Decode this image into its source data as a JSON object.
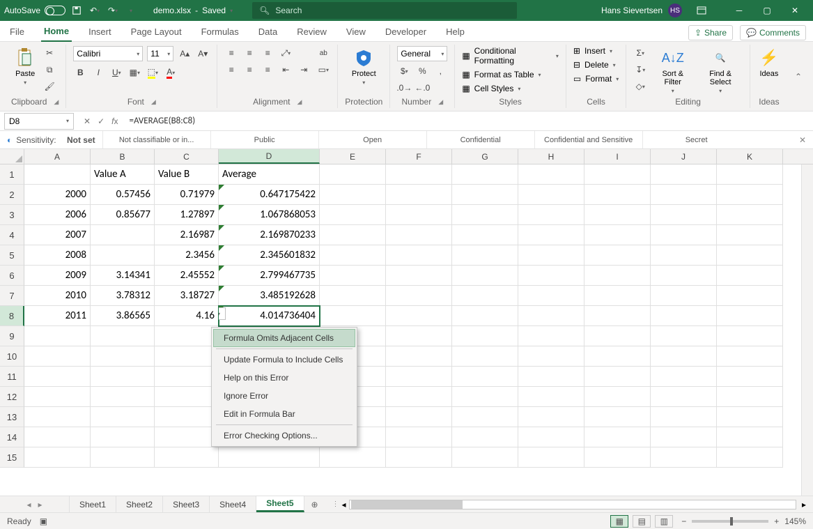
{
  "title": {
    "autosave": "AutoSave",
    "filename": "demo.xlsx",
    "saved": "Saved",
    "search_placeholder": "Search",
    "user": "Hans Sievertsen",
    "initials": "HS"
  },
  "tabs": {
    "file": "File",
    "home": "Home",
    "insert": "Insert",
    "pagelayout": "Page Layout",
    "formulas": "Formulas",
    "data": "Data",
    "review": "Review",
    "view": "View",
    "developer": "Developer",
    "help": "Help",
    "share": "Share",
    "comments": "Comments"
  },
  "ribbon": {
    "clipboard": {
      "paste": "Paste",
      "label": "Clipboard"
    },
    "font": {
      "name": "Calibri",
      "size": "11",
      "label": "Font"
    },
    "alignment": {
      "label": "Alignment"
    },
    "protection": {
      "protect": "Protect",
      "label": "Protection"
    },
    "number": {
      "format": "General",
      "label": "Number"
    },
    "styles": {
      "cond": "Conditional Formatting",
      "table": "Format as Table",
      "cell": "Cell Styles",
      "label": "Styles"
    },
    "cells": {
      "insert": "Insert",
      "delete": "Delete",
      "format": "Format",
      "label": "Cells"
    },
    "editing": {
      "sort": "Sort & Filter",
      "find": "Find & Select",
      "label": "Editing"
    },
    "ideas": {
      "ideas": "Ideas",
      "label": "Ideas"
    }
  },
  "fbar": {
    "name": "D8",
    "formula": "=AVERAGE(B8:C8)"
  },
  "sensitivity": {
    "label": "Sensitivity:",
    "value": "Not set",
    "opts": [
      "Not classifiable or in...",
      "Public",
      "Open",
      "Confidential",
      "Confidential and Sensitive",
      "Secret"
    ]
  },
  "grid": {
    "cols": [
      "A",
      "B",
      "C",
      "D",
      "E",
      "F",
      "G",
      "H",
      "I",
      "J",
      "K"
    ],
    "headers": {
      "B": "Value A",
      "C": "Value B",
      "D": "Average"
    },
    "data": [
      {
        "r": 2,
        "A": "2000",
        "B": "0.57456",
        "C": "0.71979",
        "D": "0.647175422"
      },
      {
        "r": 3,
        "A": "2006",
        "B": "0.85677",
        "C": "1.27897",
        "D": "1.067868053"
      },
      {
        "r": 4,
        "A": "2007",
        "B": "",
        "C": "2.16987",
        "D": "2.169870233"
      },
      {
        "r": 5,
        "A": "2008",
        "B": "",
        "C": "2.3456",
        "D": "2.345601832"
      },
      {
        "r": 6,
        "A": "2009",
        "B": "3.14341",
        "C": "2.45552",
        "D": "2.799467735"
      },
      {
        "r": 7,
        "A": "2010",
        "B": "3.78312",
        "C": "3.18727",
        "D": "3.485192628"
      },
      {
        "r": 8,
        "A": "2011",
        "B": "3.86565",
        "C": "4.16",
        "D": "4.014736404"
      }
    ],
    "selected": "D8",
    "err_rows": [
      2,
      3,
      4,
      5,
      6,
      7,
      8
    ]
  },
  "ctx": {
    "items": [
      "Formula Omits Adjacent Cells",
      "Update Formula to Include Cells",
      "Help on this Error",
      "Ignore Error",
      "Edit in Formula Bar",
      "Error Checking Options..."
    ]
  },
  "sheets": {
    "list": [
      "Sheet1",
      "Sheet2",
      "Sheet3",
      "Sheet4",
      "Sheet5"
    ],
    "active": "Sheet5"
  },
  "status": {
    "ready": "Ready",
    "zoom": "145%"
  }
}
